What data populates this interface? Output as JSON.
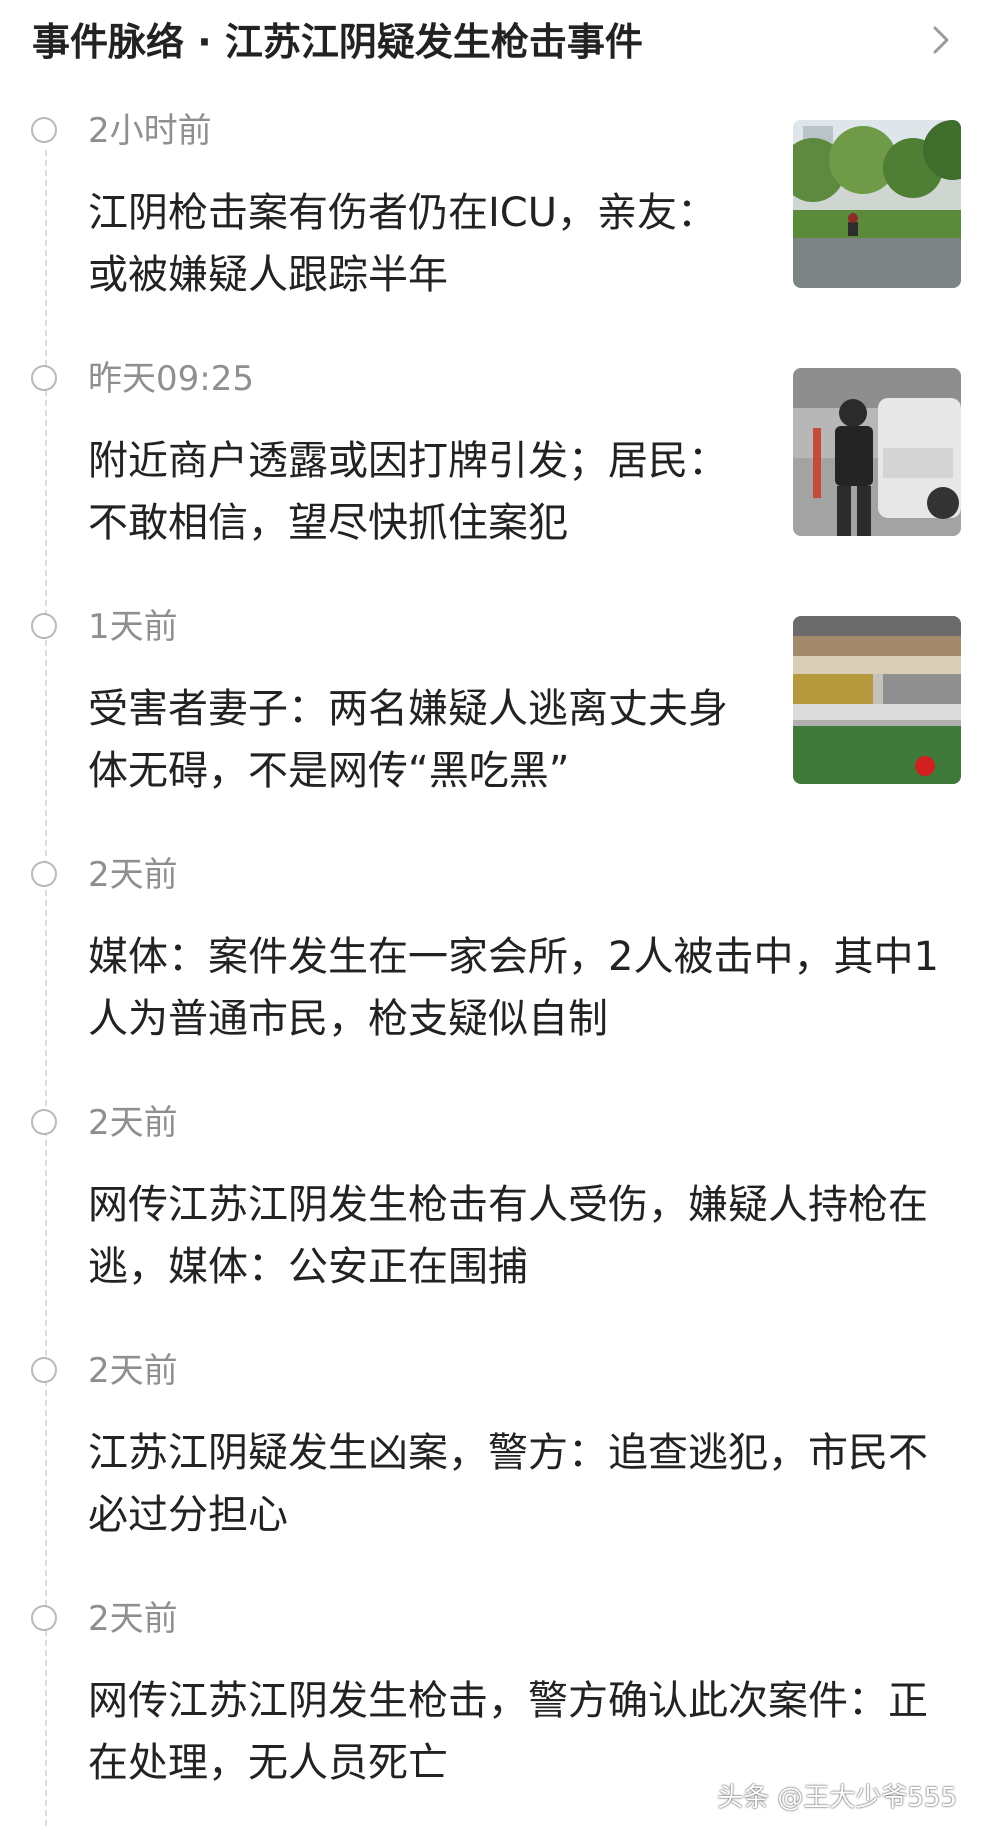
{
  "header": {
    "title": "事件脉络 · 江苏江阴疑发生枪击事件",
    "chevron_icon": "chevron-right-icon"
  },
  "events": [
    {
      "time": "2小时前",
      "title": "江阴枪击案有伤者仍在ICU，亲友：或被嫌疑人跟踪半年",
      "has_thumbnail": true
    },
    {
      "time": "昨天09:25",
      "title": "附近商户透露或因打牌引发；居民：不敢相信，望尽快抓住案犯",
      "has_thumbnail": true
    },
    {
      "time": "1天前",
      "title": "受害者妻子：两名嫌疑人逃离丈夫身体无碍，不是网传“黑吃黑”",
      "has_thumbnail": true
    },
    {
      "time": "2天前",
      "title": "媒体：案件发生在一家会所，2人被击中，其中1人为普通市民，枪支疑似自制",
      "has_thumbnail": false
    },
    {
      "time": "2天前",
      "title": "网传江苏江阴发生枪击有人受伤，嫌疑人持枪在逃，媒体：公安正在围捕",
      "has_thumbnail": false
    },
    {
      "time": "2天前",
      "title": "江苏江阴疑发生凶案，警方：追查逃犯，市民不必过分担心",
      "has_thumbnail": false
    },
    {
      "time": "2天前",
      "title": "网传江苏江阴发生枪击，警方确认此次案件：正在处理，无人员死亡",
      "has_thumbnail": false
    }
  ],
  "watermark": "头条 @王大少爷555"
}
